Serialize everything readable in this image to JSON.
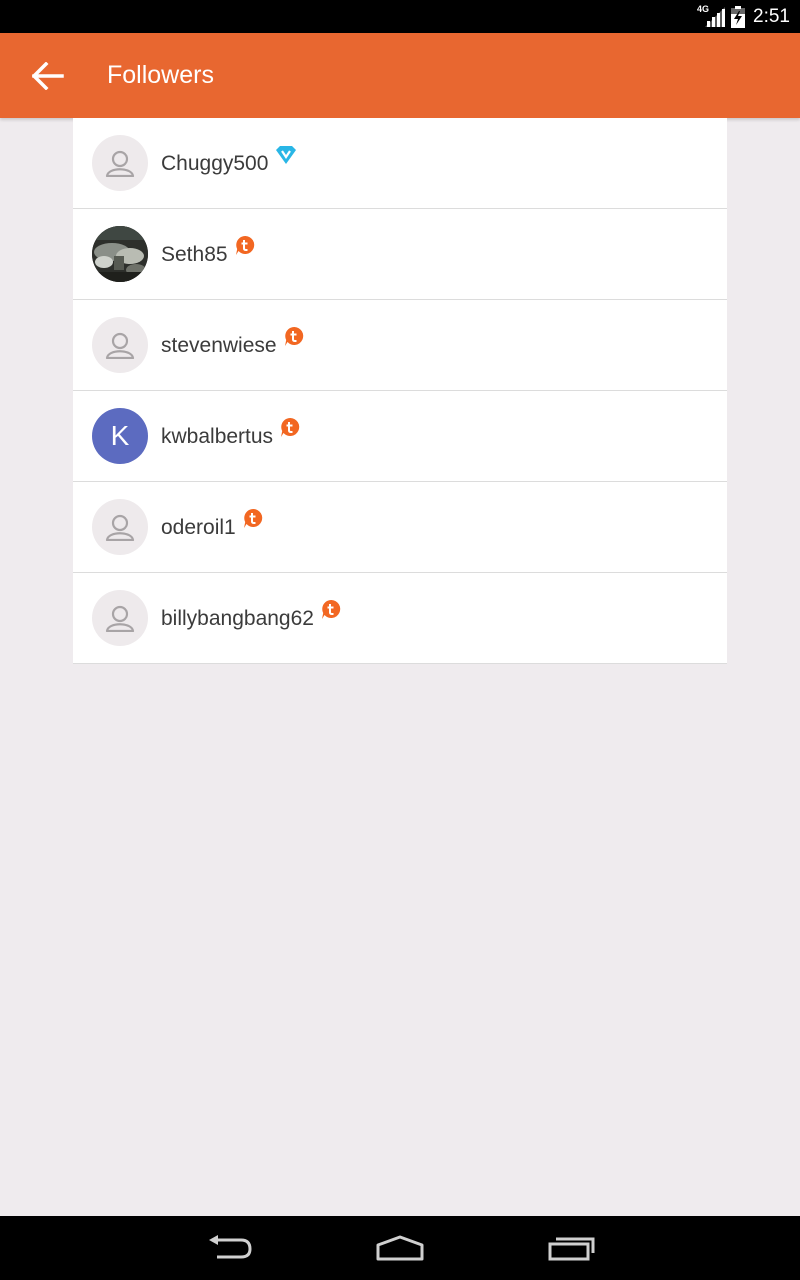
{
  "status_bar": {
    "network": "4G",
    "time": "2:51"
  },
  "app_bar": {
    "title": "Followers",
    "back_icon": "arrow-left-icon"
  },
  "followers": [
    {
      "username": "Chuggy500",
      "avatar": "placeholder",
      "badge": "verified-v-icon",
      "badge_color": "#29b6e6"
    },
    {
      "username": "Seth85",
      "avatar": "photo",
      "badge": "t-badge-icon",
      "badge_color": "#f26722"
    },
    {
      "username": "stevenwiese",
      "avatar": "placeholder",
      "badge": "t-badge-icon",
      "badge_color": "#f26722"
    },
    {
      "username": "kwbalbertus",
      "avatar": "letter",
      "avatar_letter": "K",
      "avatar_color": "#5c6bc0",
      "badge": "t-badge-icon",
      "badge_color": "#f26722"
    },
    {
      "username": "oderoil1",
      "avatar": "placeholder",
      "badge": "t-badge-icon",
      "badge_color": "#f26722"
    },
    {
      "username": "billybangbang62",
      "avatar": "placeholder",
      "badge": "t-badge-icon",
      "badge_color": "#f26722"
    }
  ],
  "colors": {
    "app_bar": "#e86730",
    "background": "#efebee"
  },
  "nav_bar": {
    "back_icon": "nav-back-icon",
    "home_icon": "nav-home-icon",
    "recents_icon": "nav-recents-icon"
  }
}
